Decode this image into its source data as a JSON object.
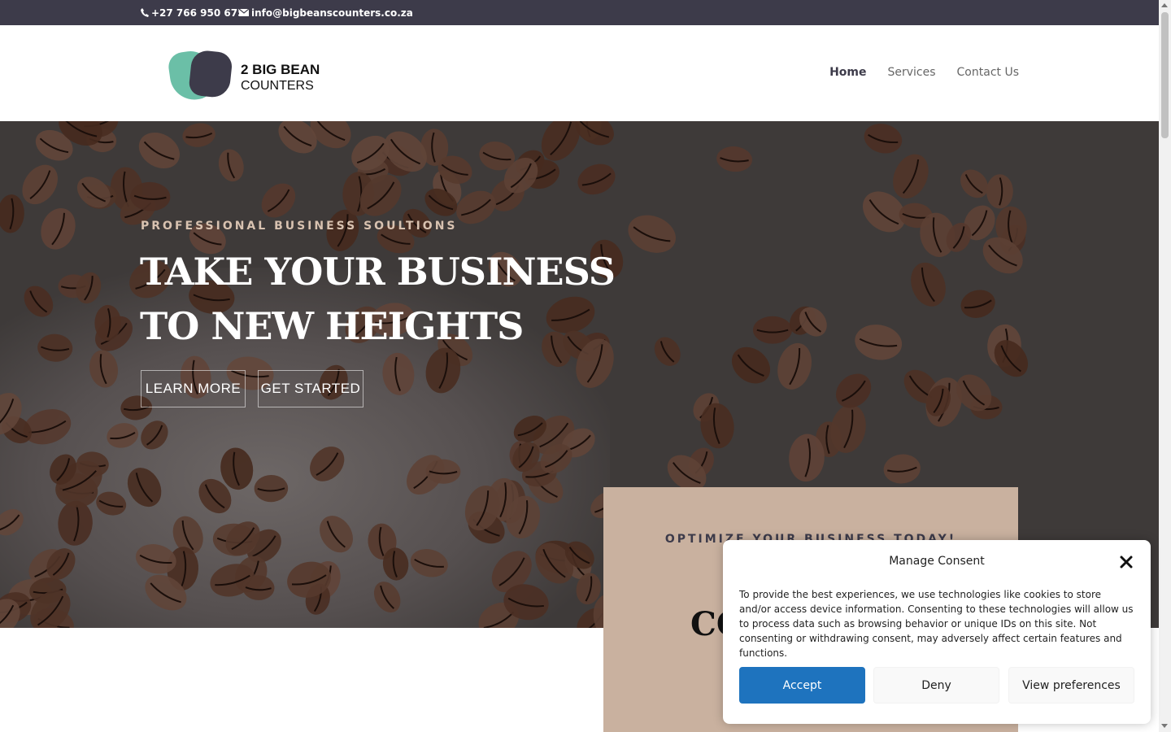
{
  "topbar": {
    "phone": "+27 766 950 675",
    "email": "info@bigbeanscounters.co.za"
  },
  "logo": {
    "line1": "2 BIG BEAN",
    "line2": "COUNTERS"
  },
  "nav": {
    "home": "Home",
    "services": "Services",
    "contact": "Contact Us"
  },
  "hero": {
    "kicker": "PROFESSIONAL BUSINESS SOULTIONS",
    "title_line1": "TAKE YOUR BUSINESS",
    "title_line2": "TO NEW HEIGHTS",
    "learn_more": "LEARN MORE",
    "get_started": "GET STARTED"
  },
  "card": {
    "kicker": "OPTIMIZE YOUR BUSINESS TODAY!",
    "title_partial": "CO"
  },
  "consent": {
    "title": "Manage Consent",
    "message": "To provide the best experiences, we use technologies like cookies to store and/or access device information. Consenting to these technologies will allow us to process data such as browsing behavior or unique IDs on this site. Not consenting or withdrawing consent, may adversely affect certain features and functions.",
    "accept": "Accept",
    "deny": "Deny",
    "view_preferences": "View preferences"
  },
  "colors": {
    "topbar": "#3d3b4a",
    "accent_tan": "#c9b19f",
    "logo_teal": "#6bbfa7",
    "accept_blue": "#1e73be"
  }
}
